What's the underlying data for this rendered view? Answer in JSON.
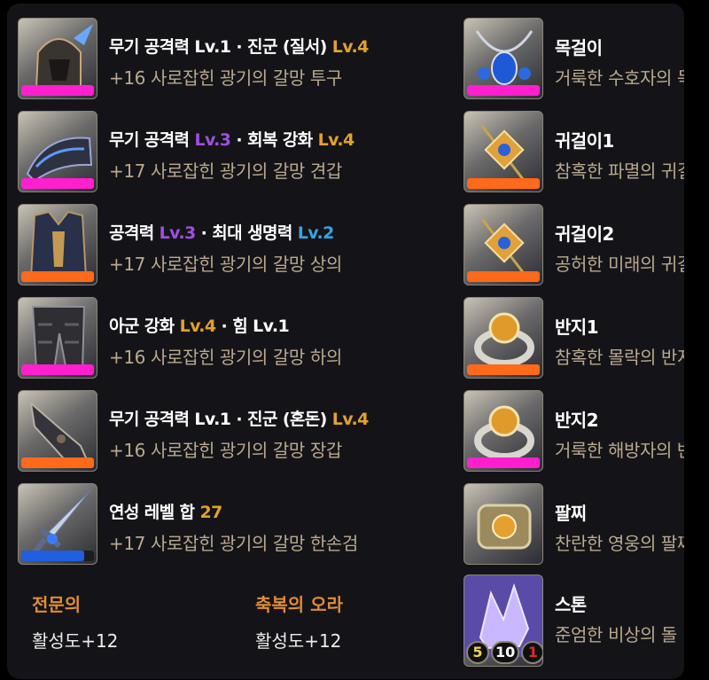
{
  "left_items": [
    {
      "line1": [
        "무기 공격력 Lv.1 · 진군 (질서) ",
        "Lv.4"
      ],
      "line1_classes": [
        "",
        "lv-or"
      ],
      "line2": "+16 사로잡힌 광기의 갈망 투구",
      "bar_color": "#ff1fcf",
      "bar_fill": 1.0,
      "icon": "helmet-icon"
    },
    {
      "line1": [
        "무기 공격력 ",
        "Lv.3",
        " · 회복 강화 ",
        "Lv.4"
      ],
      "line1_classes": [
        "",
        "lv-pu",
        "",
        "lv-or"
      ],
      "line2": "+17 사로잡힌 광기의 갈망 견갑",
      "bar_color": "#ff1fcf",
      "bar_fill": 1.0,
      "icon": "shoulder-armor-icon"
    },
    {
      "line1": [
        "공격력 ",
        "Lv.3",
        " · 최대 생명력 ",
        "Lv.2"
      ],
      "line1_classes": [
        "",
        "lv-pu",
        "",
        "lv-bl"
      ],
      "line2": "+17 사로잡힌 광기의 갈망 상의",
      "bar_color": "#ff6a1a",
      "bar_fill": 1.0,
      "icon": "chest-armor-icon"
    },
    {
      "line1": [
        "아군 강화 ",
        "Lv.4",
        " · 힘 Lv.1"
      ],
      "line1_classes": [
        "",
        "lv-or",
        ""
      ],
      "line2": "+16 사로잡힌 광기의 갈망 하의",
      "bar_color": "#ff1fcf",
      "bar_fill": 1.0,
      "icon": "leg-armor-icon"
    },
    {
      "line1": [
        "무기 공격력 Lv.1 · 진군 (혼돈) ",
        "Lv.4"
      ],
      "line1_classes": [
        "",
        "lv-or"
      ],
      "line2": "+16 사로잡힌 광기의 갈망 장갑",
      "bar_color": "#ff6a1a",
      "bar_fill": 1.0,
      "icon": "gloves-icon"
    },
    {
      "line1": [
        "연성 레벨 합 ",
        "27"
      ],
      "line1_classes": [
        "",
        "lv-or"
      ],
      "line2": "+17 사로잡힌 광기의 갈망 한손검",
      "bar_color": "#1f5fe0",
      "bar_fill": 0.87,
      "icon": "sword-icon"
    }
  ],
  "right_items": [
    {
      "line1": "목걸이",
      "line2": "거룩한 수호자의 목걸이",
      "bar_color": "#ff1fcf",
      "bar_fill": 1.0,
      "icon": "necklace-icon"
    },
    {
      "line1": "귀걸이1",
      "line2": "참혹한 파멸의 귀걸이",
      "bar_color": "#ff6a1a",
      "bar_fill": 1.0,
      "icon": "earring-icon"
    },
    {
      "line1": "귀걸이2",
      "line2": "공허한 미래의 귀걸이",
      "bar_color": "#ff6a1a",
      "bar_fill": 1.0,
      "icon": "earring-icon"
    },
    {
      "line1": "반지1",
      "line2": "참혹한 몰락의 반지",
      "bar_color": "#ff6a1a",
      "bar_fill": 1.0,
      "icon": "ring-icon"
    },
    {
      "line1": "반지2",
      "line2": "거룩한 해방자의 반지",
      "bar_color": "#ff1fcf",
      "bar_fill": 1.0,
      "icon": "ring-icon"
    },
    {
      "line1": "팔찌",
      "line2": "찬란한 영웅의 팔찌",
      "bar_color": null,
      "bar_fill": 0,
      "icon": "bracelet-icon"
    },
    {
      "line1": "스톤",
      "line2": "준엄한 비상의 돌",
      "bar_color": null,
      "bar_fill": 0,
      "icon": "stone-icon",
      "badges": [
        "5",
        "10",
        "1"
      ]
    }
  ],
  "footer": {
    "specialty_label": "전문의",
    "specialty_value": "활성도+12",
    "blessing_label": "축복의 오라",
    "blessing_value": "활성도+12"
  },
  "colors": {
    "orange": "#e3a12c",
    "purple": "#a04fe0",
    "blue": "#35a5e6",
    "badge_red": "#e02a2a"
  }
}
